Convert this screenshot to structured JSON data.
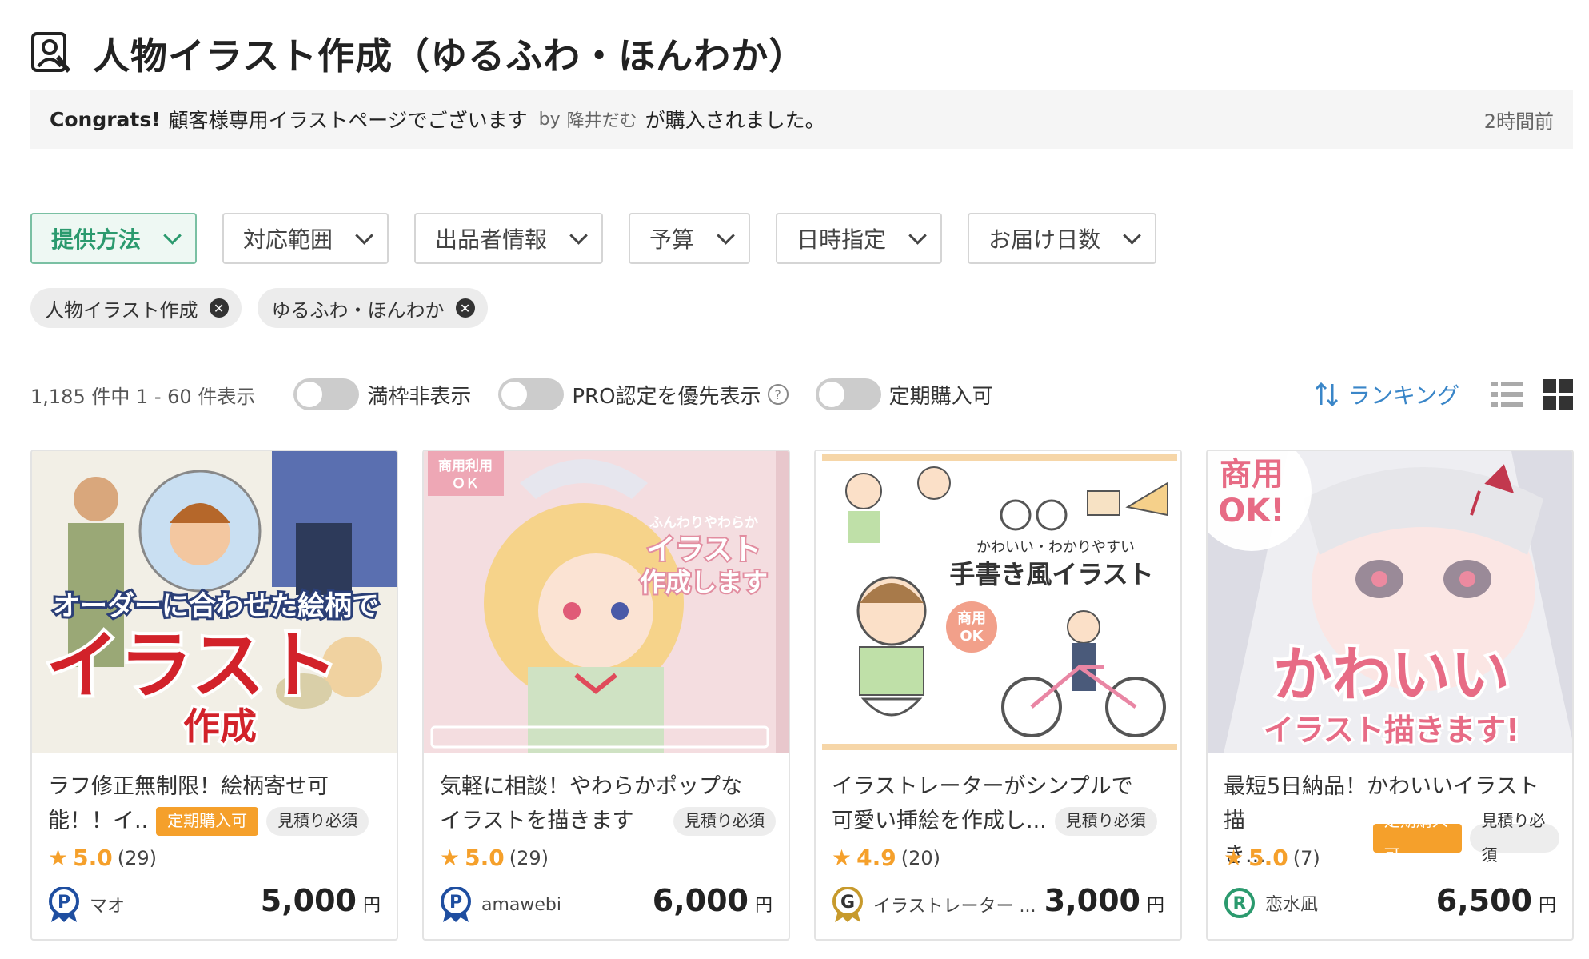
{
  "header": {
    "title": "人物イラスト作成（ゆるふわ・ほんわか）",
    "icon": "person-illustration-icon"
  },
  "notice": {
    "congrats": "Congrats!",
    "service": "顧客様専用イラストページでございます",
    "by": "by",
    "buyer": "降井だむ",
    "suffix": "が購入されました。",
    "time": "2時間前"
  },
  "filters": [
    {
      "label": "提供方法",
      "active": true
    },
    {
      "label": "対応範囲"
    },
    {
      "label": "出品者情報"
    },
    {
      "label": "予算"
    },
    {
      "label": "日時指定"
    },
    {
      "label": "お届け日数"
    }
  ],
  "chips": [
    {
      "label": "人物イラスト作成"
    },
    {
      "label": "ゆるふわ・ほんわか"
    }
  ],
  "results": {
    "count": "1,185 件中 1 - 60 件表示",
    "toggle1": "満枠非表示",
    "toggle2": "PRO認定を優先表示",
    "help": "?",
    "toggle3": "定期購入可",
    "sort": "ランキング"
  },
  "cards": [
    {
      "title_line1": "ラフ修正無制限！絵柄寄せ可",
      "title_line2": "能！！イ..",
      "tags": [
        "定期購入可",
        "見積り必須"
      ],
      "score": "5.0",
      "reviews": "(29)",
      "seller": "マオ",
      "badge": "P",
      "price": "5,000",
      "yen": "円",
      "thumb_text1": "オーダーに合わせた絵柄で",
      "thumb_text2": "イラスト",
      "thumb_text3": "作成"
    },
    {
      "title_line1": "気軽に相談！やわらかポップな",
      "title_line2": "イラストを描きます",
      "tags": [
        "見積り必須"
      ],
      "score": "5.0",
      "reviews": "(29)",
      "seller": "amawebi",
      "badge": "P",
      "price": "6,000",
      "yen": "円",
      "thumb_text1": "商用利用",
      "thumb_text2": "ＯＫ",
      "thumb_text3": "ふんわりやわらか",
      "thumb_text4": "イラスト",
      "thumb_text5": "作成します"
    },
    {
      "title_line1": "イラストレーターがシンプルで",
      "title_line2": "可愛い挿絵を作成し...",
      "tags": [
        "見積り必須"
      ],
      "score": "4.9",
      "reviews": "(20)",
      "seller": "イラストレーター ...",
      "badge": "G",
      "price": "3,000",
      "yen": "円",
      "thumb_text1": "かわいい・わかりやすい",
      "thumb_text2": "手書き風イラスト",
      "thumb_text3": "商用",
      "thumb_text4": "OK"
    },
    {
      "title_line1": "最短5日納品！かわいいイラスト",
      "title_line2": "描き...",
      "tags": [
        "定期購入可",
        "見積り必須"
      ],
      "score": "5.0",
      "reviews": "(7)",
      "seller": "恋水凪",
      "badge": "R",
      "price": "6,500",
      "yen": "円",
      "thumb_text1": "商用",
      "thumb_text2": "OK!",
      "thumb_text3": "かわいい",
      "thumb_text4": "イラスト描きます!"
    }
  ],
  "colors": {
    "accent": "#2b9a6e",
    "orange": "#f5a02b",
    "link": "#3a86c8"
  }
}
